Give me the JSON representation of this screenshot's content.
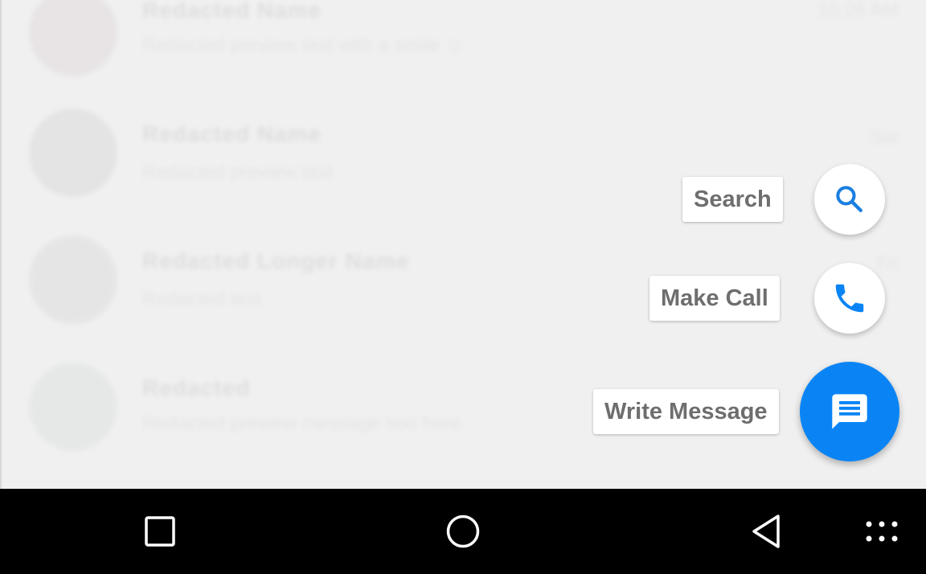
{
  "conversations": [
    {
      "name": "Redacted Name",
      "snippet": "Redacted preview text with a smile ☺",
      "time": "10:26 AM"
    },
    {
      "name": "Redacted Name",
      "snippet": "Redacted preview text",
      "time": "Sat"
    },
    {
      "name": "Redacted Longer Name",
      "snippet": "Redacted text",
      "time": "Fri"
    },
    {
      "name": "Redacted",
      "snippet": "Redacted preview message text here",
      "time": ""
    }
  ],
  "speed_dial": {
    "search": {
      "label": "Search",
      "icon": "search-icon"
    },
    "make_call": {
      "label": "Make Call",
      "icon": "phone-icon"
    },
    "write_message": {
      "label": "Write Message",
      "icon": "message-icon"
    }
  },
  "colors": {
    "accent": "#0a84f5",
    "label_text": "#6e6e6e",
    "background": "#f0f0f0",
    "navbar": "#000000"
  },
  "navbar": {
    "recents": {
      "icon": "square-icon"
    },
    "home": {
      "icon": "circle-icon"
    },
    "back": {
      "icon": "triangle-back-icon"
    },
    "apps": {
      "icon": "grid-dots-icon"
    }
  }
}
